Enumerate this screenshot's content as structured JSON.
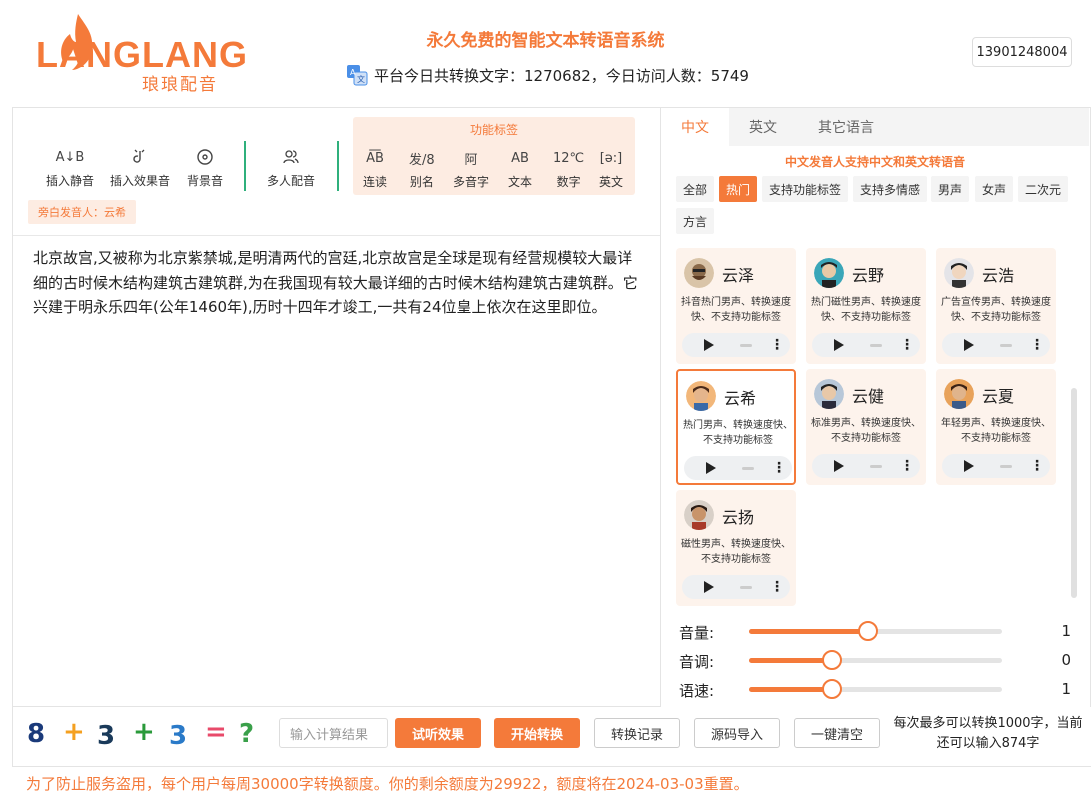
{
  "header": {
    "logo_text": "LANGLANG",
    "logo_sub": "琅琅配音",
    "site_title": "永久免费的智能文本转语音系统",
    "stats_text": "平台今日共转换文字：1270682，今日访问人数：5749",
    "user": "13901248004"
  },
  "toolbar": {
    "insert_silence": "插入静音",
    "insert_effect": "插入效果音",
    "background_music": "背景音",
    "multi_voice": "多人配音",
    "func_title": "功能标签",
    "func_tags": [
      {
        "icon": "A͞B",
        "label": "连读"
      },
      {
        "icon": "发/8",
        "label": "别名"
      },
      {
        "icon": "阿",
        "label": "多音字"
      },
      {
        "icon": "AB",
        "label": "文本"
      },
      {
        "icon": "12℃",
        "label": "数字"
      },
      {
        "icon": "[ə:]",
        "label": "英文"
      }
    ],
    "narrator": "旁白发音人：云希"
  },
  "editor": {
    "text": "北京故宫,又被称为北京紫禁城,是明清两代的宫廷,北京故宫是全球是现有经营规模较大最详细的古时候木结构建筑古建筑群,为在我国现有较大最详细的古时候木结构建筑古建筑群。它兴建于明永乐四年(公年1460年),历时十四年才竣工,一共有24位皇上依次在这里即位。"
  },
  "panel": {
    "tabs": [
      "中文",
      "英文",
      "其它语言"
    ],
    "lang_note": "中文发音人支持中文和英文转语音",
    "filters": [
      "全部",
      "热门",
      "支持功能标签",
      "支持多情感",
      "男声",
      "女声",
      "二次元",
      "方言"
    ],
    "voices": [
      {
        "name": "云泽",
        "desc": "抖音热门男声、转换速度快、不支持功能标签"
      },
      {
        "name": "云野",
        "desc": "热门磁性男声、转换速度快、不支持功能标签"
      },
      {
        "name": "云浩",
        "desc": "广告宣传男声、转换速度快、不支持功能标签"
      },
      {
        "name": "云希",
        "desc": "热门男声、转换速度快、不支持功能标签"
      },
      {
        "name": "云健",
        "desc": "标准男声、转换速度快、不支持功能标签"
      },
      {
        "name": "云夏",
        "desc": "年轻男声、转换速度快、不支持功能标签"
      },
      {
        "name": "云扬",
        "desc": "磁性男声、转换速度快、不支持功能标签"
      }
    ],
    "sliders": [
      {
        "label": "音量:",
        "value": "1",
        "fraction": 0.47
      },
      {
        "label": "音调:",
        "value": "0",
        "fraction": 0.33
      },
      {
        "label": "语速:",
        "value": "1",
        "fraction": 0.33
      }
    ]
  },
  "bottom": {
    "captcha": [
      "8",
      "+",
      "3",
      "+",
      "3",
      "=",
      "?"
    ],
    "calc_placeholder": "输入计算结果",
    "preview": "试听效果",
    "convert": "开始转换",
    "history": "转换记录",
    "import": "源码导入",
    "clear": "一键清空",
    "limit_note": "每次最多可以转换1000字，当前还可以输入874字",
    "quota": "为了防止服务盗用，每个用户每周30000字转换额度。你的剩余额度为29922，额度将在2024-03-03重置。"
  },
  "colors": {
    "accent": "#f47a3a",
    "accent_light": "#fdece2",
    "divider": "#2fb07c"
  }
}
